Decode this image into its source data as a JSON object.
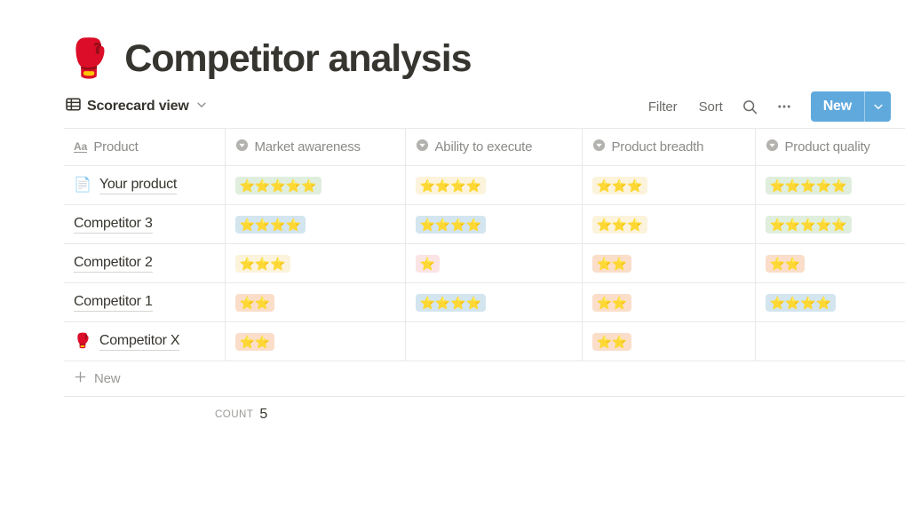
{
  "page": {
    "title": "Competitor analysis",
    "title_emoji": "🥊"
  },
  "toolbar": {
    "view_name": "Scorecard view",
    "view_icon": "table-view-icon",
    "view_caret_icon": "chevron-down-icon",
    "filter_label": "Filter",
    "sort_label": "Sort",
    "search_icon": "search-icon",
    "more_icon": "ellipsis-icon",
    "new_label": "New",
    "new_caret_icon": "chevron-down-icon",
    "new_button_color": "#60a9dd"
  },
  "table": {
    "columns": [
      {
        "label": "Product",
        "type_icon": "text-type-icon"
      },
      {
        "label": "Market awareness",
        "type_icon": "select-type-icon"
      },
      {
        "label": "Ability to execute",
        "type_icon": "select-type-icon"
      },
      {
        "label": "Product breadth",
        "type_icon": "select-type-icon"
      },
      {
        "label": "Product quality",
        "type_icon": "select-type-icon"
      }
    ],
    "rows": [
      {
        "name": "Your product",
        "emoji": "📄",
        "emoji_name": "page-icon",
        "cells": [
          {
            "stars": "⭐⭐⭐⭐⭐",
            "count": 5,
            "color": "#dfeedd"
          },
          {
            "stars": "⭐⭐⭐⭐",
            "count": 4,
            "color": "#fbf3db"
          },
          {
            "stars": "⭐⭐⭐",
            "count": 3,
            "color": "#fbf3db"
          },
          {
            "stars": "⭐⭐⭐⭐⭐",
            "count": 5,
            "color": "#dfeedd"
          }
        ]
      },
      {
        "name": "Competitor 3",
        "emoji": "",
        "emoji_name": "",
        "cells": [
          {
            "stars": "⭐⭐⭐⭐",
            "count": 4,
            "color": "#d3e5ef"
          },
          {
            "stars": "⭐⭐⭐⭐",
            "count": 4,
            "color": "#d3e5ef"
          },
          {
            "stars": "⭐⭐⭐",
            "count": 3,
            "color": "#fbf3db"
          },
          {
            "stars": "⭐⭐⭐⭐⭐",
            "count": 5,
            "color": "#dfeedd"
          }
        ]
      },
      {
        "name": "Competitor 2",
        "emoji": "",
        "emoji_name": "",
        "cells": [
          {
            "stars": "⭐⭐⭐",
            "count": 3,
            "color": "#fbf3db"
          },
          {
            "stars": "⭐",
            "count": 1,
            "color": "#fbe4e4"
          },
          {
            "stars": "⭐⭐",
            "count": 2,
            "color": "#fadec9"
          },
          {
            "stars": "⭐⭐",
            "count": 2,
            "color": "#fadec9"
          }
        ]
      },
      {
        "name": "Competitor 1",
        "emoji": "",
        "emoji_name": "",
        "cells": [
          {
            "stars": "⭐⭐",
            "count": 2,
            "color": "#fadec9"
          },
          {
            "stars": "⭐⭐⭐⭐",
            "count": 4,
            "color": "#d3e5ef"
          },
          {
            "stars": "⭐⭐",
            "count": 2,
            "color": "#fadec9"
          },
          {
            "stars": "⭐⭐⭐⭐",
            "count": 4,
            "color": "#d3e5ef"
          }
        ]
      },
      {
        "name": "Competitor X",
        "emoji": "🥊",
        "emoji_name": "boxing-glove-icon",
        "cells": [
          {
            "stars": "⭐⭐",
            "count": 2,
            "color": "#fadec9"
          },
          {
            "stars": "",
            "count": 0,
            "color": ""
          },
          {
            "stars": "⭐⭐",
            "count": 2,
            "color": "#fadec9"
          },
          {
            "stars": "",
            "count": 0,
            "color": ""
          }
        ]
      }
    ],
    "new_row_label": "New",
    "new_row_icon": "plus-icon",
    "count_label": "Count",
    "count_value": "5"
  }
}
